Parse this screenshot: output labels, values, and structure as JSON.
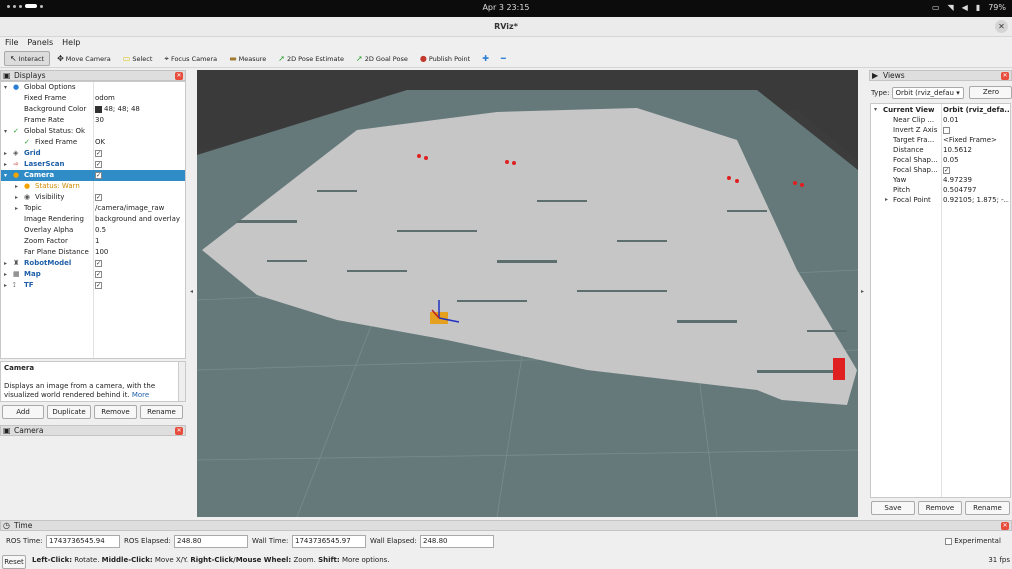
{
  "system": {
    "clock": "Apr 3  23:15",
    "battery": "79%"
  },
  "window": {
    "title": "RViz*"
  },
  "menu": [
    "File",
    "Panels",
    "Help"
  ],
  "toolbar": [
    {
      "label": "Interact",
      "icon": "cursor-icon"
    },
    {
      "label": "Move Camera",
      "icon": "move-icon"
    },
    {
      "label": "Select",
      "icon": "select-icon"
    },
    {
      "label": "Focus Camera",
      "icon": "focus-icon"
    },
    {
      "label": "Measure",
      "icon": "ruler-icon"
    },
    {
      "label": "2D Pose Estimate",
      "icon": "green-arrow-icon"
    },
    {
      "label": "2D Goal Pose",
      "icon": "green-arrow-icon"
    },
    {
      "label": "Publish Point",
      "icon": "pin-icon"
    }
  ],
  "displays": {
    "title": "Displays",
    "rows": [
      {
        "label": "Global Options",
        "value": ""
      },
      {
        "label": "Fixed Frame",
        "value": "odom"
      },
      {
        "label": "Background Color",
        "value": "48; 48; 48"
      },
      {
        "label": "Frame Rate",
        "value": "30"
      },
      {
        "label": "Global Status: Ok",
        "value": ""
      },
      {
        "label": "Fixed Frame",
        "value": "OK"
      },
      {
        "label": "Grid",
        "value": ""
      },
      {
        "label": "LaserScan",
        "value": ""
      },
      {
        "label": "Camera",
        "value": ""
      },
      {
        "label": "Status: Warn",
        "value": ""
      },
      {
        "label": "Visibility",
        "value": ""
      },
      {
        "label": "Topic",
        "value": "/camera/image_raw"
      },
      {
        "label": "Image Rendering",
        "value": "background and overlay"
      },
      {
        "label": "Overlay Alpha",
        "value": "0.5"
      },
      {
        "label": "Zoom Factor",
        "value": "1"
      },
      {
        "label": "Far Plane Distance",
        "value": "100"
      },
      {
        "label": "RobotModel",
        "value": ""
      },
      {
        "label": "Map",
        "value": ""
      },
      {
        "label": "TF",
        "value": ""
      }
    ],
    "description_title": "Camera",
    "description_text": "Displays an image from a camera, with the visualized world rendered behind it.",
    "description_link": "More",
    "buttons": [
      "Add",
      "Duplicate",
      "Remove",
      "Rename"
    ]
  },
  "camera_panel": {
    "title": "Camera"
  },
  "views": {
    "title": "Views",
    "type_label": "Type:",
    "type_value": "Orbit (rviz_defau",
    "zero_label": "Zero",
    "current_label": "Current View",
    "current_value": "Orbit (rviz_defa...",
    "rows": [
      {
        "label": "Near Clip ...",
        "value": "0.01"
      },
      {
        "label": "Invert Z Axis",
        "value": ""
      },
      {
        "label": "Target Fra...",
        "value": "<Fixed Frame>"
      },
      {
        "label": "Distance",
        "value": "10.5612"
      },
      {
        "label": "Focal Shap...",
        "value": "0.05"
      },
      {
        "label": "Focal Shap...",
        "value": ""
      },
      {
        "label": "Yaw",
        "value": "4.97239"
      },
      {
        "label": "Pitch",
        "value": "0.504797"
      },
      {
        "label": "Focal Point",
        "value": "0.92105; 1.875; -..."
      }
    ],
    "buttons": [
      "Save",
      "Remove",
      "Rename"
    ]
  },
  "time": {
    "title": "Time",
    "ros_time_label": "ROS Time:",
    "ros_time": "1743736545.94",
    "ros_elapsed_label": "ROS Elapsed:",
    "ros_elapsed": "248.80",
    "wall_time_label": "Wall Time:",
    "wall_time": "1743736545.97",
    "wall_elapsed_label": "Wall Elapsed:",
    "wall_elapsed": "248.80",
    "experimental_label": "Experimental"
  },
  "status": {
    "reset_label": "Reset",
    "hint_left_click": "Left-Click:",
    "hint_left_click_text": "Rotate.",
    "hint_middle_click": "Middle-Click:",
    "hint_middle_click_text": "Move X/Y.",
    "hint_right_click": "Right-Click/Mouse Wheel:",
    "hint_right_click_text": "Zoom.",
    "hint_shift": "Shift:",
    "hint_shift_text": "More options.",
    "fps": "31 fps"
  },
  "colors": {
    "selection": "#308cc6",
    "viewport_bg": "#303030",
    "ground": "#66797a",
    "map_free": "#c8c8c8",
    "link": "#1f5fa8"
  }
}
